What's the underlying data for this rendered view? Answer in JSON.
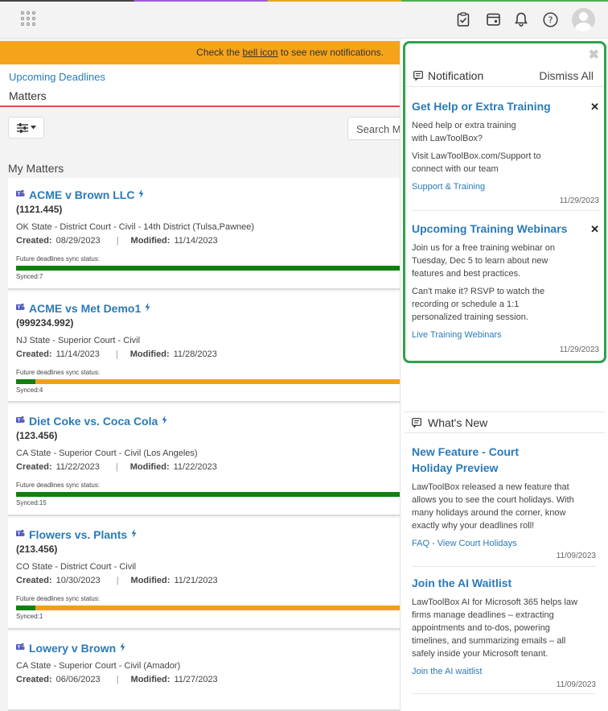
{
  "topbar": {
    "icons": [
      "app-launcher-icon",
      "clipboard-icon",
      "calendar-icon",
      "bell-icon",
      "help-icon",
      "user-avatar-icon"
    ]
  },
  "banner": {
    "prefix": "Check the ",
    "link": "bell icon",
    "suffix": " to see new notifications."
  },
  "header": {
    "breadcrumb": "Upcoming Deadlines",
    "title": "Matters"
  },
  "search": {
    "placeholder": "Search Ma"
  },
  "section_title": "My Matters",
  "labels": {
    "created": "Created:",
    "modified": "Modified:",
    "sync_status": "Future deadlines sync status:"
  },
  "matters": [
    {
      "name": "ACME v Brown LLC",
      "number": "(1121.445)",
      "court": "OK State - District Court - Civil - 14th District (Tulsa,Pawnee)",
      "created": "08/29/2023",
      "modified": "11/14/2023",
      "synced": "Synced:7",
      "progress_green": 1.0,
      "progress_orange": 0.0
    },
    {
      "name": "ACME vs Met Demo1",
      "number": "(999234.992)",
      "court": "NJ State - Superior Court - Civil",
      "created": "11/14/2023",
      "modified": "11/28/2023",
      "synced": "Synced:4",
      "progress_green": 0.05,
      "progress_orange": 1.0
    },
    {
      "name": "Diet Coke vs. Coca Cola",
      "number": "(123.456)",
      "court": "CA State - Superior Court - Civil (Los Angeles)",
      "created": "11/22/2023",
      "modified": "11/22/2023",
      "synced": "Synced:15",
      "progress_green": 1.0,
      "progress_orange": 0.0
    },
    {
      "name": "Flowers vs. Plants",
      "number": "(213.456)",
      "court": "CO State - District Court - Civil",
      "created": "10/30/2023",
      "modified": "11/21/2023",
      "synced": "Synced:1",
      "progress_green": 0.05,
      "progress_orange": 1.0
    },
    {
      "name": "Lowery v Brown",
      "number": "",
      "court": "CA State - Superior Court - Civil (Amador)",
      "created": "06/06/2023",
      "modified": "11/27/2023",
      "synced": "",
      "progress_green": 0,
      "progress_orange": 0
    }
  ],
  "notifications": {
    "header": "Notification",
    "dismiss_all": "Dismiss All",
    "items": [
      {
        "title": "Get Help or Extra Training",
        "p1": "Need help or extra training with LawToolBox?",
        "p2": "Visit LawToolBox.com/Support to connect with our team",
        "link": "Support & Training",
        "date": "11/29/2023"
      },
      {
        "title": "Upcoming Training Webinars",
        "p1": "Join us for a free training webinar on Tuesday, Dec 5 to learn about new features and best practices.",
        "p2": "Can't make it? RSVP to watch the recording or schedule a 1:1 personalized training session.",
        "link": "Live Training Webinars",
        "date": "11/29/2023"
      }
    ]
  },
  "whats_new": {
    "header": "What's New",
    "items": [
      {
        "title": "New Feature - Court Holiday Preview",
        "p1": "LawToolBox released a new feature that allows you to see the court holidays. With many holidays around the corner, know exactly why your deadlines roll!",
        "link": "FAQ - View Court Holidays",
        "date": "11/09/2023"
      },
      {
        "title": "Join the AI Waitlist",
        "p1": "LawToolBox AI for Microsoft 365 helps law firms manage deadlines – extracting appointments and to-dos, powering timelines, and summarizing emails – all safely inside your Microsoft tenant.",
        "link": "Join the AI waitlist",
        "date": "11/09/2023"
      }
    ]
  },
  "colors": {
    "accent_blue": "#2a7ab8",
    "banner_orange": "#f5a31a",
    "sync_green": "#108010",
    "sync_orange": "#f0a01a",
    "notif_border": "#2fa14b"
  }
}
